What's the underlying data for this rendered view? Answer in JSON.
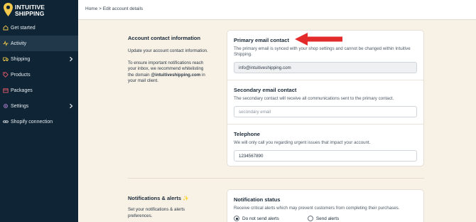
{
  "app": {
    "brand_line1": "INTUITIVE",
    "brand_line2": "SHIPPING",
    "brand_color": "#f2c94c"
  },
  "sidebar": {
    "items": [
      {
        "label": "Get started",
        "icon": "home-icon"
      },
      {
        "label": "Activity",
        "icon": "activity-icon",
        "active": true
      },
      {
        "label": "Shipping",
        "icon": "truck-icon",
        "expandable": true
      },
      {
        "label": "Products",
        "icon": "tag-icon"
      },
      {
        "label": "Packages",
        "icon": "package-icon"
      },
      {
        "label": "Settings",
        "icon": "gear-icon",
        "expandable": true
      },
      {
        "label": "Shopify connection",
        "icon": "link-icon"
      }
    ]
  },
  "breadcrumb": {
    "home": "Home",
    "separator": ">",
    "current": "Edit account details"
  },
  "account_contact": {
    "title": "Account contact information",
    "desc1": "Update your account contact information.",
    "desc2_prefix": "To ensure important notifications reach your inbox, we recommend whitelisting the domain ",
    "desc2_domain": "@intuitiveshipping.com",
    "desc2_suffix": " in your mail client."
  },
  "primary_email": {
    "title": "Primary email contact",
    "desc": "The primary email is synced with your shop settings and cannot be changed within Intuitive Shipping.",
    "value": "info@intuitiveshipping.com"
  },
  "secondary_email": {
    "title": "Secondary email contact",
    "desc": "The secondary contact will receive all communications sent to the primary contact.",
    "placeholder": "secondary email"
  },
  "telephone": {
    "title": "Telephone",
    "desc": "We will only call you regarding urgent issues that impact your account.",
    "value": "1234567890"
  },
  "notifications": {
    "title": "Notifications & alerts",
    "sparkle": "✨",
    "desc": "Set your notifications & alerts preferences.",
    "status_title": "Notification status",
    "status_desc": "Receive critical alerts which may prevent customers from completing their purchases.",
    "option_off": "Do not send alerts",
    "option_on": "Send alerts",
    "selected": "Do not send alerts"
  },
  "annotation_arrow_color": "#e32b2b"
}
